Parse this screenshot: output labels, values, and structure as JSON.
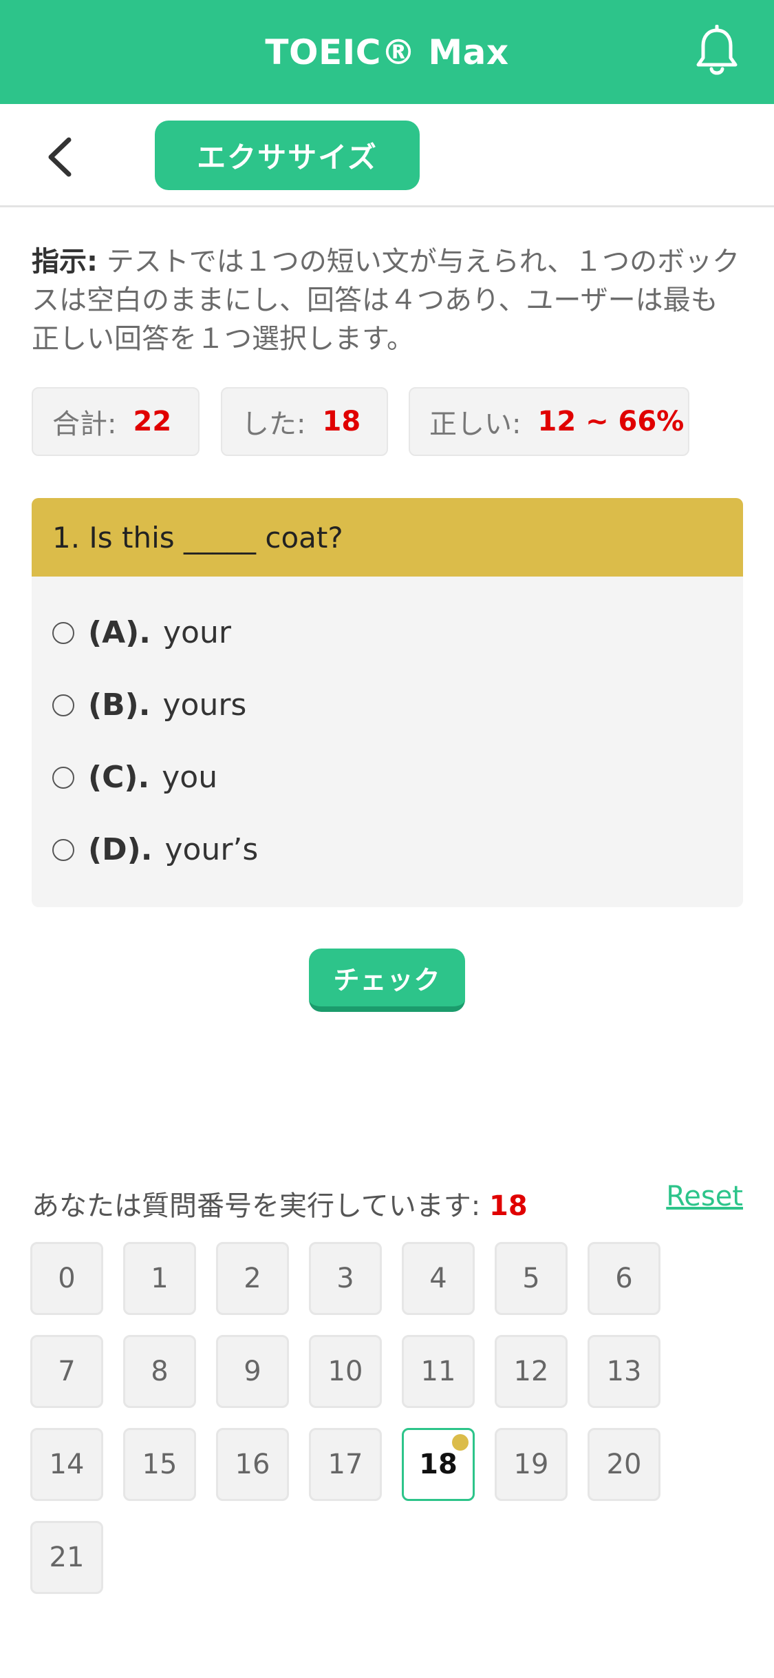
{
  "header": {
    "title": "TOEIC® Max",
    "icons": [
      "bell-icon"
    ]
  },
  "subheader": {
    "back_icon": "chevron-left-icon",
    "tab_label": "エクササイズ"
  },
  "instructions": {
    "lead": "指示:",
    "text": " テストでは１つの短い文が与えられ、１つのボックスは空白のままにし、回答は４つあり、ユーザーは最も正しい回答を１つ選択します。"
  },
  "stats": {
    "total_label": "合計:",
    "total_value": "22",
    "done_label": "した:",
    "done_value": "18",
    "correct_label": "正しい:",
    "correct_value": "12 ~ 66%"
  },
  "question": {
    "title": "1. Is this _____ coat?",
    "options": [
      {
        "letter": "(A).",
        "text": "your"
      },
      {
        "letter": "(B).",
        "text": "yours"
      },
      {
        "letter": "(C).",
        "text": "you"
      },
      {
        "letter": "(D).",
        "text": "your’s"
      }
    ]
  },
  "check_button_label": "チェック",
  "progress": {
    "label": "あなたは質問番号を実行しています: ",
    "current": "18",
    "reset_label": "Reset",
    "numbers": [
      "0",
      "1",
      "2",
      "3",
      "4",
      "5",
      "6",
      "7",
      "8",
      "9",
      "10",
      "11",
      "12",
      "13",
      "14",
      "15",
      "16",
      "17",
      "18",
      "19",
      "20",
      "21"
    ],
    "active_index": 18
  },
  "colors": {
    "brand_green": "#2dc48a",
    "question_gold": "#dbbc4a",
    "accent_red": "#e00000"
  }
}
